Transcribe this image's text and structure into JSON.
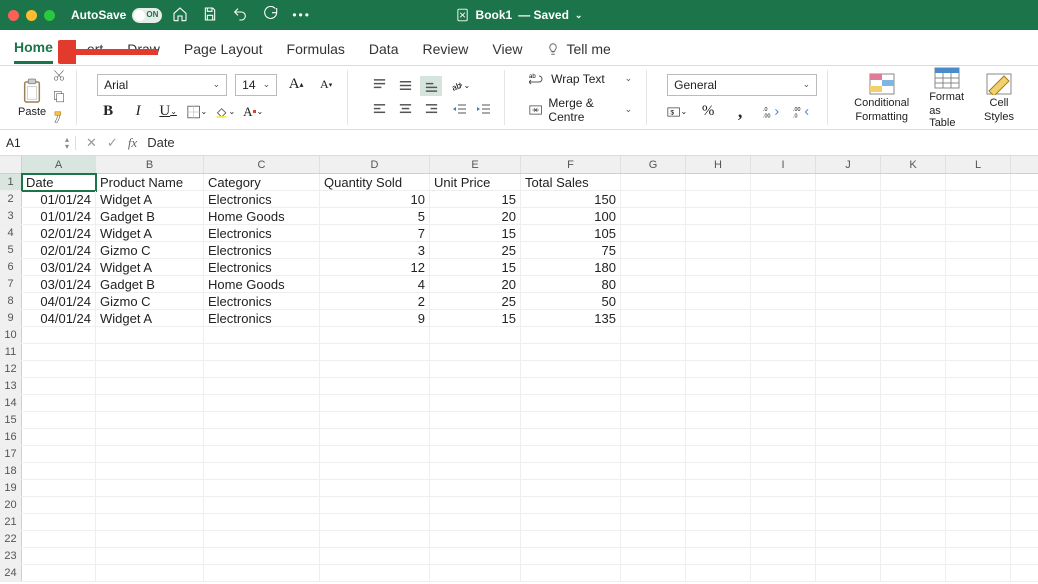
{
  "titlebar": {
    "autosave": "AutoSave",
    "toggle_state": "ON",
    "doc_name": "Book1",
    "saved_suffix": "— Saved"
  },
  "tabs": {
    "home": "Home",
    "insert": "ert",
    "draw": "Draw",
    "page_layout": "Page Layout",
    "formulas": "Formulas",
    "data": "Data",
    "review": "Review",
    "view": "View",
    "tell_me": "Tell me"
  },
  "ribbon": {
    "paste": "Paste",
    "font_name": "Arial",
    "font_size": "14",
    "wrap_text": "Wrap Text",
    "merge_centre": "Merge & Centre",
    "number_format": "General",
    "cond_fmt_l1": "Conditional",
    "cond_fmt_l2": "Formatting",
    "fmt_table_l1": "Format",
    "fmt_table_l2": "as Table",
    "cell_styles_l1": "Cell",
    "cell_styles_l2": "Styles"
  },
  "fxbar": {
    "cell_ref": "A1",
    "fx_label": "fx",
    "value": "Date"
  },
  "columns": [
    "A",
    "B",
    "C",
    "D",
    "E",
    "F",
    "G",
    "H",
    "I",
    "J",
    "K",
    "L"
  ],
  "headers": {
    "A": "Date",
    "B": "Product Name",
    "C": "Category",
    "D": "Quantity Sold",
    "E": "Unit Price",
    "F": "Total Sales"
  },
  "rows": [
    {
      "A": "01/01/24",
      "B": "Widget A",
      "C": "Electronics",
      "D": 10,
      "E": 15,
      "F": 150
    },
    {
      "A": "01/01/24",
      "B": "Gadget B",
      "C": "Home Goods",
      "D": 5,
      "E": 20,
      "F": 100
    },
    {
      "A": "02/01/24",
      "B": "Widget A",
      "C": "Electronics",
      "D": 7,
      "E": 15,
      "F": 105
    },
    {
      "A": "02/01/24",
      "B": "Gizmo C",
      "C": "Electronics",
      "D": 3,
      "E": 25,
      "F": 75
    },
    {
      "A": "03/01/24",
      "B": "Widget A",
      "C": "Electronics",
      "D": 12,
      "E": 15,
      "F": 180
    },
    {
      "A": "03/01/24",
      "B": "Gadget B",
      "C": "Home Goods",
      "D": 4,
      "E": 20,
      "F": 80
    },
    {
      "A": "04/01/24",
      "B": "Gizmo C",
      "C": "Electronics",
      "D": 2,
      "E": 25,
      "F": 50
    },
    {
      "A": "04/01/24",
      "B": "Widget A",
      "C": "Electronics",
      "D": 9,
      "E": 15,
      "F": 135
    }
  ],
  "row_count_visible": 24
}
